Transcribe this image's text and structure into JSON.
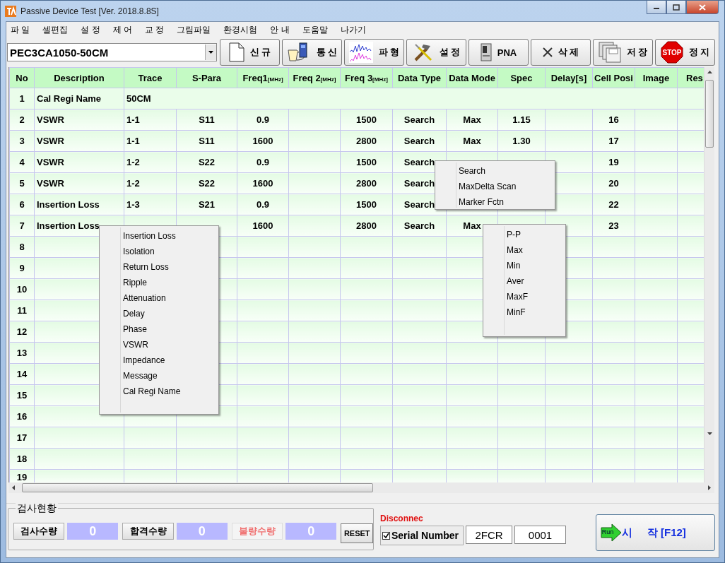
{
  "window": {
    "title": "Passive Device Test [Ver. 2018.8.8S]"
  },
  "menu": [
    "파 일",
    "셀편집",
    "설 정",
    "제 어",
    "교 정",
    "그림파일",
    "환경시험",
    "안 내",
    "도움말",
    "나가기"
  ],
  "toolbar": {
    "model_select": {
      "value": "PEC3CA1050-50CM"
    },
    "buttons": [
      {
        "label": "신 규"
      },
      {
        "label": "통 신"
      },
      {
        "label": "파 형"
      },
      {
        "label": "설 정"
      },
      {
        "label": "PNA"
      },
      {
        "label": "삭 제"
      },
      {
        "label": "저 장"
      },
      {
        "label": "정 지",
        "icon_label": "STOP"
      }
    ]
  },
  "table": {
    "columns": [
      {
        "label": "No"
      },
      {
        "label": "Description"
      },
      {
        "label": "Trace"
      },
      {
        "label": "S-Para"
      },
      {
        "label": "Freq1",
        "unit": "[MHz]"
      },
      {
        "label": "Freq 2",
        "unit": "[MHz]"
      },
      {
        "label": "Freq 3",
        "unit": "[MHz]"
      },
      {
        "label": "Data Type"
      },
      {
        "label": "Data Mode"
      },
      {
        "label": "Spec"
      },
      {
        "label": "Delay[s]"
      },
      {
        "label": "Cell Posi"
      },
      {
        "label": "Image"
      },
      {
        "label": "Res"
      }
    ],
    "rows": [
      {
        "kind": "name",
        "no": "1",
        "description": "Cal Regi Name",
        "value": "50CM"
      },
      {
        "kind": "data",
        "no": "2",
        "description": "VSWR",
        "trace": "1-1",
        "s_para": "S11",
        "freq1": "0.9",
        "freq3": "1500",
        "data_type": "Search",
        "data_mode": "Max",
        "spec": "1.15",
        "cell_posi": "16"
      },
      {
        "kind": "data",
        "no": "3",
        "description": "VSWR",
        "trace": "1-1",
        "s_para": "S11",
        "freq1": "1600",
        "freq3": "2800",
        "data_type": "Search",
        "data_mode": "Max",
        "spec": "1.30",
        "cell_posi": "17"
      },
      {
        "kind": "data",
        "no": "4",
        "description": "VSWR",
        "trace": "1-2",
        "s_para": "S22",
        "freq1": "0.9",
        "freq3": "1500",
        "data_type": "Search",
        "cell_posi": "19"
      },
      {
        "kind": "data",
        "no": "5",
        "description": "VSWR",
        "trace": "1-2",
        "s_para": "S22",
        "freq1": "1600",
        "freq3": "2800",
        "data_type": "Search",
        "cell_posi": "20"
      },
      {
        "kind": "data",
        "no": "6",
        "description": "Insertion Loss",
        "trace": "1-3",
        "s_para": "S21",
        "freq1": "0.9",
        "freq3": "1500",
        "data_type": "Search",
        "cell_posi": "22"
      },
      {
        "kind": "data",
        "no": "7",
        "description": "Insertion Loss",
        "freq1": "1600",
        "freq3": "2800",
        "data_type": "Search",
        "data_mode": "Max",
        "cell_posi": "23"
      },
      {
        "kind": "data",
        "no": "8"
      },
      {
        "kind": "data",
        "no": "9"
      },
      {
        "kind": "data",
        "no": "10"
      },
      {
        "kind": "data",
        "no": "11"
      },
      {
        "kind": "data",
        "no": "12"
      },
      {
        "kind": "data",
        "no": "13"
      },
      {
        "kind": "data",
        "no": "14"
      },
      {
        "kind": "data",
        "no": "15"
      },
      {
        "kind": "data",
        "no": "16"
      },
      {
        "kind": "data",
        "no": "17"
      },
      {
        "kind": "data",
        "no": "18"
      },
      {
        "kind": "data",
        "no": "19"
      }
    ]
  },
  "context_menus": [
    {
      "items": [
        "Insertion Loss",
        "Isolation",
        "Return Loss",
        "Ripple",
        "Attenuation",
        "Delay",
        "Phase",
        "VSWR",
        "Impedance",
        "Message",
        "Cal Regi Name"
      ]
    },
    {
      "items": [
        "Search",
        "MaxDelta Scan",
        "Marker Fctn"
      ]
    },
    {
      "items": [
        "P-P",
        "Max",
        "Min",
        "Aver",
        "MaxF",
        "MinF"
      ]
    }
  ],
  "status_panel": {
    "title": "검사현황",
    "counters": [
      {
        "kind": "total",
        "label": "검사수량",
        "value": "0"
      },
      {
        "kind": "pass",
        "label": "합격수량",
        "value": "0"
      },
      {
        "kind": "fail",
        "label": "불량수량",
        "value": "0"
      }
    ],
    "reset_button": "RESET"
  },
  "connection": {
    "status": "Disconnec"
  },
  "serial": {
    "label": "Serial Number",
    "checked": true,
    "prefix": "2FCR",
    "number": "0001"
  },
  "start_button": {
    "label": "시     작 [F12]",
    "icon_label": "Run"
  }
}
